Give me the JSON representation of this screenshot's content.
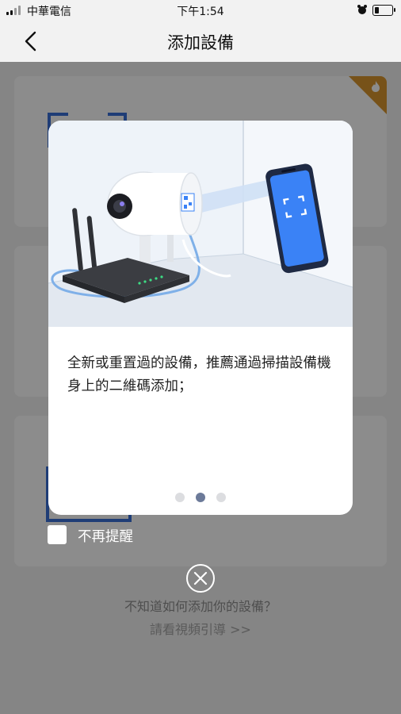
{
  "status_bar": {
    "carrier": "中華電信",
    "time": "下午1:54"
  },
  "nav": {
    "title": "添加設備",
    "back_icon": "chevron-left-icon"
  },
  "modal": {
    "message": "全新或重置過的設備，推薦通過掃描設備機身上的二維碼添加；",
    "page_count": 3,
    "current_page": 2
  },
  "checkbox": {
    "label": "不再提醒",
    "checked": false
  },
  "close_icon": "close-circle-icon",
  "help": {
    "line1": "不知道如何添加你的設備？",
    "link": "請看視頻引導 >>"
  },
  "colors": {
    "accent_blue": "#3a82f6",
    "ribbon": "#d9962e",
    "dot_active": "#6c7a99"
  }
}
